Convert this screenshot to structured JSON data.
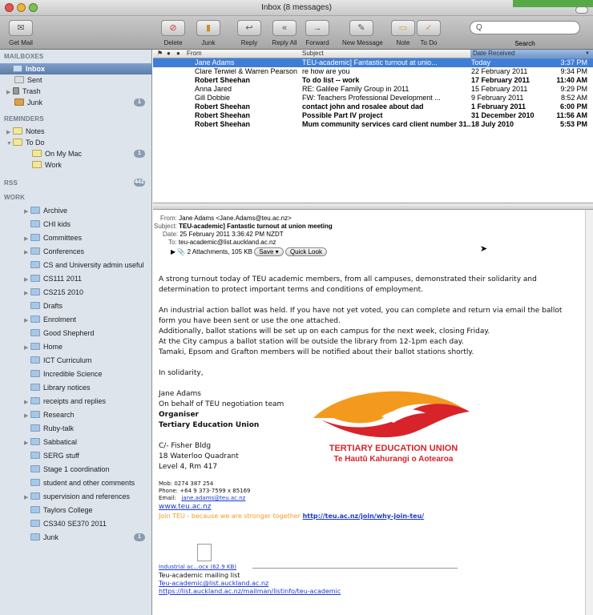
{
  "window": {
    "title": "Inbox (8 messages)"
  },
  "toolbar": {
    "get_mail": "Get Mail",
    "delete": "Delete",
    "junk": "Junk",
    "reply": "Reply",
    "reply_all": "Reply All",
    "forward": "Forward",
    "new_message": "New Message",
    "note": "Note",
    "todo": "To Do",
    "search_label": "Search",
    "search_value": "Q"
  },
  "sidebar": {
    "mailboxes": "MAILBOXES",
    "inbox": "Inbox",
    "sent": "Sent",
    "trash": "Trash",
    "junk": "Junk",
    "junk_count": "1",
    "reminders": "REMINDERS",
    "notes": "Notes",
    "todo": "To Do",
    "on_my_mac": "On My Mac",
    "on_my_mac_count": "1",
    "work": "Work",
    "rss": "RSS",
    "rss_count": "442",
    "work_section": "WORK",
    "folders": [
      "Archive",
      "CHI kids",
      "Committees",
      "Conferences",
      "CS and University admin useful",
      "CS111 2011",
      "CS215 2010",
      "Drafts",
      "Enrolment",
      "Good Shepherd",
      "Home",
      "ICT Curriculum",
      "Incredible Science",
      "Library notices",
      "receipts and replies",
      "Research",
      "Ruby-talk",
      "Sabbatical",
      "SERG stuff",
      "Stage 1 coordination",
      "student and other comments",
      "supervision and references",
      "Taylors College",
      "CS340 SE370 2011",
      "Junk"
    ],
    "folder_junk_count": "1"
  },
  "columns": {
    "from": "From",
    "subject": "Subject",
    "date": "Date Received"
  },
  "messages": [
    {
      "from": "Jane Adams",
      "subject": "TEU-academic] Fantastic turnout at  unio...",
      "date": "Today",
      "time": "3:37 PM",
      "bold": false,
      "note": false
    },
    {
      "from": "Clare Terwiel & Warren Pearson",
      "subject": "re how are you",
      "date": "22 February 2011",
      "time": "9:34 PM",
      "bold": false,
      "note": false
    },
    {
      "from": "Robert Sheehan",
      "subject": "To do list -- work",
      "date": "17 February 2011",
      "time": "11:40 AM",
      "bold": true,
      "note": true
    },
    {
      "from": "Anna Jared",
      "subject": "RE: Galilee Family Group in 2011",
      "date": "15 February 2011",
      "time": "9:29 PM",
      "bold": false,
      "note": false
    },
    {
      "from": "Gill Dobbie",
      "subject": "FW: Teachers Professional Development ...",
      "date": "9 February 2011",
      "time": "8:52 AM",
      "bold": false,
      "note": false
    },
    {
      "from": "Robert Sheehan",
      "subject": "contact john and rosalee about dad",
      "date": "1 February 2011",
      "time": "6:00 PM",
      "bold": true,
      "note": true
    },
    {
      "from": "Robert Sheehan",
      "subject": "Possible Part IV project",
      "date": "31 December 2010",
      "time": "11:56 AM",
      "bold": true,
      "note": true
    },
    {
      "from": "Robert Sheehan",
      "subject": "Mum community services card client number 31...",
      "date": "18 July 2010",
      "time": "5:53 PM",
      "bold": true,
      "note": true
    }
  ],
  "header": {
    "from_k": "From:",
    "from_v": "Jane Adams <Jane.Adams@teu.ac.nz>",
    "subject_k": "Subject:",
    "subject_v": "TEU-academic] Fantastic turnout at  union meeting",
    "date_k": "Date:",
    "date_v": "25 February 2011 3:36:42 PM NZDT",
    "to_k": "To:",
    "to_v": "teu-academic@list.auckland.ac.nz",
    "attach": "2 Attachments, 105 KB",
    "save": "Save",
    "quicklook": "Quick Look"
  },
  "body": {
    "p1a": "A strong turnout today of TEU academic members, from all campuses, demonstrated their solidarity and",
    "p1b": "determination to protect important terms and conditions of employment.",
    "p2a": "An industrial action ballot was held. If you have not yet voted, you can complete and return via email the ballot",
    "p2b": "form you have been sent or use the one attached.",
    "p2c": "Additionally, ballot stations will be set up on each campus for the next week, closing Friday.",
    "p2d": "At the City campus a ballot station will be outside the library from 12-1pm each day.",
    "p2e": "Tamaki, Epsom and Grafton members will be notified about their ballot stations shortly.",
    "sol": "In solidarity,",
    "sig1": "Jane Adams",
    "sig2": "On behalf of TEU negotiation team",
    "sig3": "Organiser",
    "sig4": "Tertiary Education Union",
    "addr1": "C/- Fisher Bldg",
    "addr2": "18 Waterloo Quadrant",
    "addr3": "Level 4, Rm 417",
    "mob": "Mob: 0274 387 254",
    "phone": "Phone:    +64 9 373-7599 x 85169",
    "email_k": "Email:",
    "email_v": "jane.adams@teu.ac.nz",
    "web": "www.teu.ac.nz",
    "join": "Join TEU - because we are stronger together",
    "join_link": "http://teu.ac.nz/join/why-join-teu/",
    "logo1": "TERTIARY EDUCATION UNION",
    "logo2": "Te Hautū Kahurangi o Aotearoa",
    "attach_name": "Industrial ac...ocx (62.9 KB)",
    "ml1": "Teu-academic mailing list",
    "ml2": "Teu-academic@list.auckland.ac.nz",
    "ml3": "https://list.auckland.ac.nz/mailman/listinfo/teu-academic"
  },
  "colors": {
    "sidebar": "#dde4ec",
    "selection": "#3f7ed8",
    "logo_red": "#d8232a",
    "logo_orange": "#f39a1e",
    "link": "#1a3acf"
  }
}
